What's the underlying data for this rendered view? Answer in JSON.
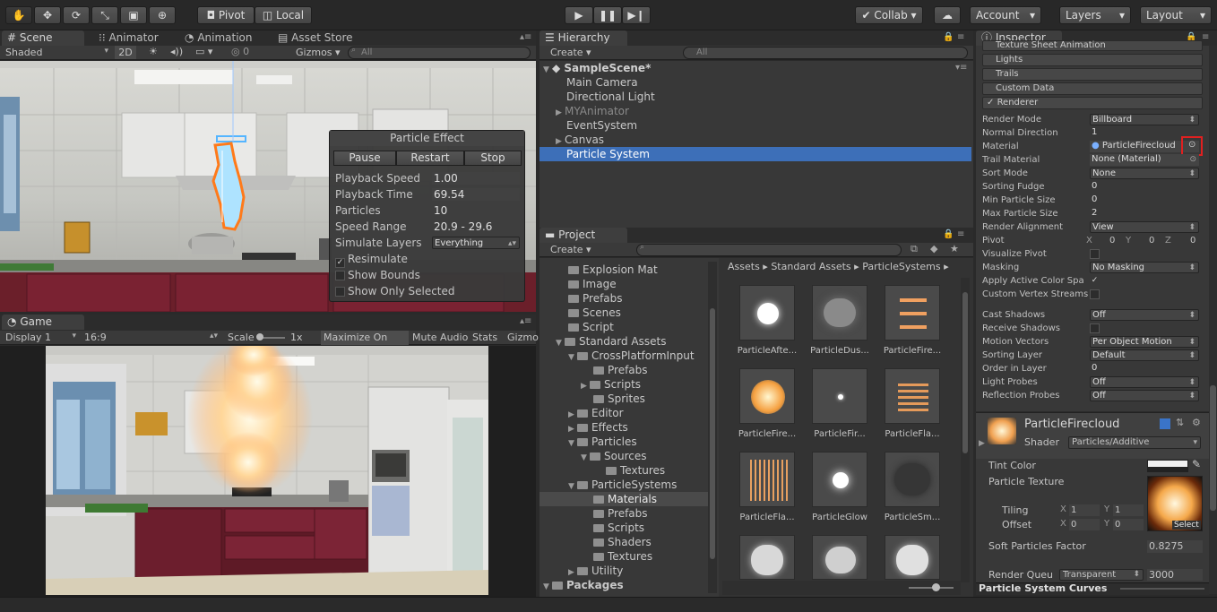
{
  "toolbar": {
    "pivot": "Pivot",
    "local": "Local",
    "collab": "Collab",
    "account": "Account",
    "layers": "Layers",
    "layout": "Layout"
  },
  "scene": {
    "tabs": [
      "Scene",
      "Animator",
      "Animation",
      "Asset Store"
    ],
    "shaded": "Shaded",
    "mode_2d": "2D",
    "gizmos": "Gizmos",
    "search_placeholder": "All"
  },
  "particle_effect": {
    "title": "Particle Effect",
    "buttons": [
      "Pause",
      "Restart",
      "Stop"
    ],
    "playback_speed_label": "Playback Speed",
    "playback_speed": "1.00",
    "playback_time_label": "Playback Time",
    "playback_time": "69.54",
    "particles_label": "Particles",
    "particles": "10",
    "speed_range_label": "Speed Range",
    "speed_range": "20.9 - 29.6",
    "simulate_layers_label": "Simulate Layers",
    "simulate_layers": "Everything",
    "resimulate": "Resimulate",
    "show_bounds": "Show Bounds",
    "show_only_selected": "Show Only Selected"
  },
  "game": {
    "tab": "Game",
    "display": "Display 1",
    "aspect": "16:9",
    "scale_label": "Scale",
    "scale_value": "1x",
    "maximize": "Maximize On Play",
    "mute": "Mute Audio",
    "stats": "Stats",
    "gizmos": "Gizmo"
  },
  "hierarchy": {
    "tab": "Hierarchy",
    "create": "Create",
    "search_placeholder": "All",
    "scene": "SampleScene*",
    "items": [
      "Main Camera",
      "Directional Light",
      "MYAnimator",
      "EventSystem",
      "Canvas",
      "Particle System"
    ]
  },
  "project": {
    "tab": "Project",
    "create": "Create",
    "tree": [
      "Explosion Mat",
      "Image",
      "Prefabs",
      "Scenes",
      "Script",
      "Standard Assets",
      "CrossPlatformInput",
      "Prefabs",
      "Scripts",
      "Sprites",
      "Editor",
      "Effects",
      "Particles",
      "Sources",
      "Textures",
      "ParticleSystems",
      "Materials",
      "Prefabs",
      "Scripts",
      "Shaders",
      "Textures",
      "Utility",
      "Packages"
    ],
    "breadcrumb": [
      "Assets",
      "Standard Assets",
      "ParticleSystems"
    ],
    "assets": [
      "ParticleAfte...",
      "ParticleDus...",
      "ParticleFire...",
      "ParticleFire...",
      "ParticleFir...",
      "ParticleFla...",
      "ParticleFla...",
      "ParticleGlow",
      "ParticleSm..."
    ]
  },
  "inspector": {
    "tab": "Inspector",
    "modules": [
      "Texture Sheet Animation",
      "Lights",
      "Trails",
      "Custom Data",
      "Renderer"
    ],
    "renderer": [
      {
        "label": "Render Mode",
        "value": "Billboard"
      },
      {
        "label": "Normal Direction",
        "value": "1"
      },
      {
        "label": "Material",
        "value": "ParticleFirecloud"
      },
      {
        "label": "Trail Material",
        "value": "None (Material)"
      },
      {
        "label": "Sort Mode",
        "value": "None"
      },
      {
        "label": "Sorting Fudge",
        "value": "0"
      },
      {
        "label": "Min Particle Size",
        "value": "0"
      },
      {
        "label": "Max Particle Size",
        "value": "2"
      },
      {
        "label": "Render Alignment",
        "value": "View"
      },
      {
        "label": "Pivot",
        "value": ""
      },
      {
        "label": "Visualize Pivot",
        "value": ""
      },
      {
        "label": "Masking",
        "value": "No Masking"
      },
      {
        "label": "Apply Active Color Spa",
        "value": ""
      },
      {
        "label": "Custom Vertex Streams",
        "value": ""
      },
      {
        "label": "Cast Shadows",
        "value": "Off"
      },
      {
        "label": "Receive Shadows",
        "value": ""
      },
      {
        "label": "Motion Vectors",
        "value": "Per Object Motion"
      },
      {
        "label": "Sorting Layer",
        "value": "Default"
      },
      {
        "label": "Order in Layer",
        "value": "0"
      },
      {
        "label": "Light Probes",
        "value": "Off"
      },
      {
        "label": "Reflection Probes",
        "value": "Off"
      }
    ],
    "pivot_x_label": "X",
    "pivot_x": "0",
    "pivot_y_label": "Y",
    "pivot_y": "0",
    "pivot_z_label": "Z",
    "pivot_z": "0",
    "material_name": "ParticleFirecloud",
    "shader_label": "Shader",
    "shader": "Particles/Additive",
    "tint_color": "Tint Color",
    "particle_texture": "Particle Texture",
    "tiling": "Tiling",
    "offset": "Offset",
    "tiling_x_label": "X",
    "tiling_x": "1",
    "tiling_y_label": "Y",
    "tiling_y": "1",
    "offset_x_label": "X",
    "offset_x": "0",
    "offset_y_label": "Y",
    "offset_y": "0",
    "select": "Select",
    "soft_particles_label": "Soft Particles Factor",
    "soft_particles": "0.8275",
    "render_queue_label": "Render Queu",
    "render_queue_mode": "Transparent",
    "render_queue_value": "3000",
    "curves_title": "Particle System Curves"
  },
  "colors": {
    "selection": "#3d6fb8",
    "highlight_box": "#e02020",
    "flame": "#ff8a2a"
  }
}
